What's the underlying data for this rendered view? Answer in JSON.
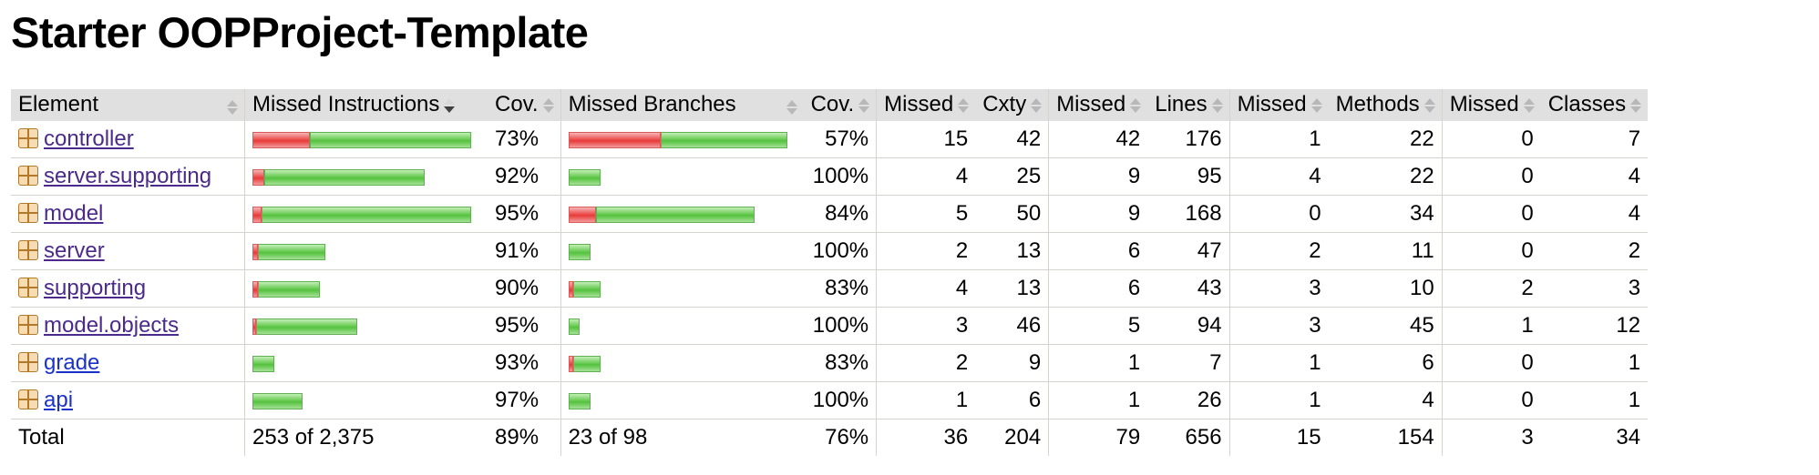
{
  "title": "Starter OOPProject-Template",
  "headers": {
    "element": "Element",
    "missed_instructions": "Missed Instructions",
    "cov": "Cov.",
    "missed_branches": "Missed Branches",
    "cov2": "Cov.",
    "missed_cxty": "Missed",
    "cxty": "Cxty",
    "missed_lines": "Missed",
    "lines": "Lines",
    "missed_methods": "Missed",
    "methods": "Methods",
    "missed_classes": "Missed",
    "classes": "Classes"
  },
  "colors": {
    "missed": "#e83a3a",
    "covered": "#55c23e",
    "header_bg": "#e0e0e0"
  },
  "rows": [
    {
      "name": "controller",
      "instr_missed_frac": 0.264,
      "instr_covered_frac": 0.736,
      "instr_cov": "73%",
      "branch_missed_frac": 0.42,
      "branch_covered_frac": 0.58,
      "branch_cov": "57%",
      "missed_cxty": "15",
      "cxty": "42",
      "missed_lines": "42",
      "lines": "176",
      "missed_methods": "1",
      "methods": "22",
      "missed_classes": "0",
      "classes": "7"
    },
    {
      "name": "server.supporting",
      "instr_missed_frac": 0.055,
      "instr_covered_frac": 0.735,
      "instr_cov": "92%",
      "branch_missed_frac": 0.0,
      "branch_covered_frac": 0.145,
      "branch_cov": "100%",
      "missed_cxty": "4",
      "cxty": "25",
      "missed_lines": "9",
      "lines": "95",
      "missed_methods": "4",
      "methods": "22",
      "missed_classes": "0",
      "classes": "4"
    },
    {
      "name": "model",
      "instr_missed_frac": 0.04,
      "instr_covered_frac": 0.96,
      "instr_cov": "95%",
      "branch_missed_frac": 0.123,
      "branch_covered_frac": 0.727,
      "branch_cov": "84%",
      "missed_cxty": "5",
      "cxty": "50",
      "missed_lines": "9",
      "lines": "168",
      "missed_methods": "0",
      "methods": "34",
      "missed_classes": "0",
      "classes": "4"
    },
    {
      "name": "server",
      "instr_missed_frac": 0.023,
      "instr_covered_frac": 0.307,
      "instr_cov": "91%",
      "branch_missed_frac": 0.0,
      "branch_covered_frac": 0.1,
      "branch_cov": "100%",
      "missed_cxty": "2",
      "cxty": "13",
      "missed_lines": "6",
      "lines": "47",
      "missed_methods": "2",
      "methods": "11",
      "missed_classes": "0",
      "classes": "2"
    },
    {
      "name": "supporting",
      "instr_missed_frac": 0.023,
      "instr_covered_frac": 0.283,
      "instr_cov": "90%",
      "branch_missed_frac": 0.02,
      "branch_covered_frac": 0.125,
      "branch_cov": "83%",
      "missed_cxty": "4",
      "cxty": "13",
      "missed_lines": "6",
      "lines": "43",
      "missed_methods": "3",
      "methods": "10",
      "missed_classes": "2",
      "classes": "3"
    },
    {
      "name": "model.objects",
      "instr_missed_frac": 0.018,
      "instr_covered_frac": 0.462,
      "instr_cov": "95%",
      "branch_missed_frac": 0.0,
      "branch_covered_frac": 0.052,
      "branch_cov": "100%",
      "missed_cxty": "3",
      "cxty": "46",
      "missed_lines": "5",
      "lines": "94",
      "missed_methods": "3",
      "methods": "45",
      "missed_classes": "1",
      "classes": "12"
    },
    {
      "name": "grade",
      "instr_missed_frac": 0.0,
      "instr_covered_frac": 0.098,
      "instr_cov": "93%",
      "branch_missed_frac": 0.02,
      "branch_covered_frac": 0.125,
      "branch_cov": "83%",
      "missed_cxty": "2",
      "cxty": "9",
      "missed_lines": "1",
      "lines": "7",
      "missed_methods": "1",
      "methods": "6",
      "missed_classes": "0",
      "classes": "1"
    },
    {
      "name": "api",
      "instr_missed_frac": 0.0,
      "instr_covered_frac": 0.228,
      "instr_cov": "97%",
      "branch_missed_frac": 0.0,
      "branch_covered_frac": 0.1,
      "branch_cov": "100%",
      "missed_cxty": "1",
      "cxty": "6",
      "missed_lines": "1",
      "lines": "26",
      "missed_methods": "1",
      "methods": "4",
      "missed_classes": "0",
      "classes": "1"
    }
  ],
  "total": {
    "label": "Total",
    "instructions": "253 of 2,375",
    "instr_cov": "89%",
    "branches": "23 of 98",
    "branch_cov": "76%",
    "missed_cxty": "36",
    "cxty": "204",
    "missed_lines": "79",
    "lines": "656",
    "missed_methods": "15",
    "methods": "154",
    "missed_classes": "3",
    "classes": "34"
  }
}
